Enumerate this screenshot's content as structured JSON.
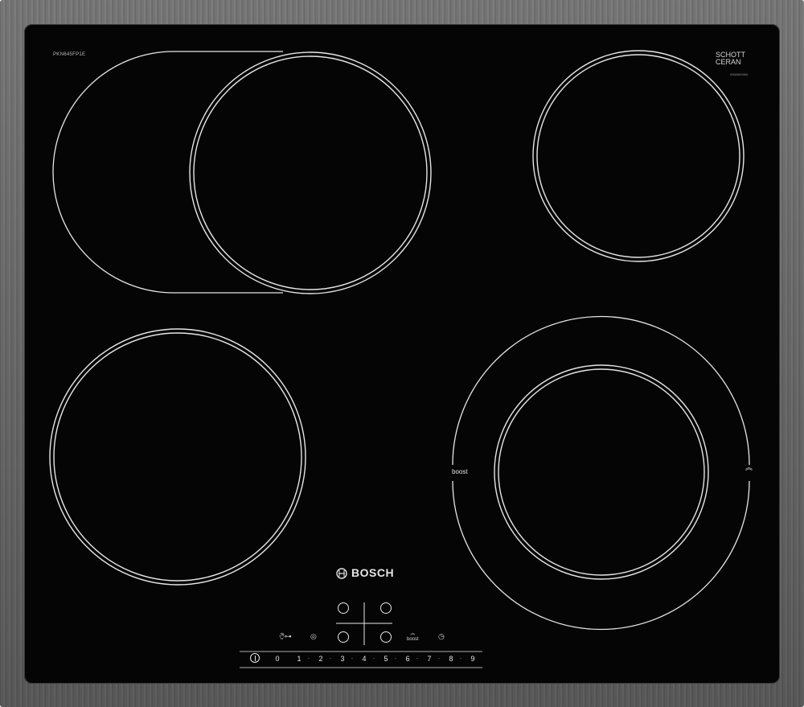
{
  "product": {
    "model": "PKN645FP1E",
    "glass_brand_line1": "SCHOTT",
    "glass_brand_line2": "CERAN",
    "serial": "0000000000",
    "brand": "BOSCH"
  },
  "zones": {
    "boost_label": "boost",
    "boost_arrows": "≈"
  },
  "controls": {
    "lock_icon": "child-lock-icon",
    "wipe_icon": "wipe-protection-icon",
    "boost_small_label": "boost",
    "timer_icon": "timer-icon",
    "power_icon": "power-icon",
    "scale": [
      "0",
      "1",
      "2",
      "3",
      "4",
      "5",
      "6",
      "7",
      "8",
      "9"
    ]
  },
  "colors": {
    "glass": "#050505",
    "marking": "#e6e6e6",
    "frame": "#a0a0a0"
  }
}
